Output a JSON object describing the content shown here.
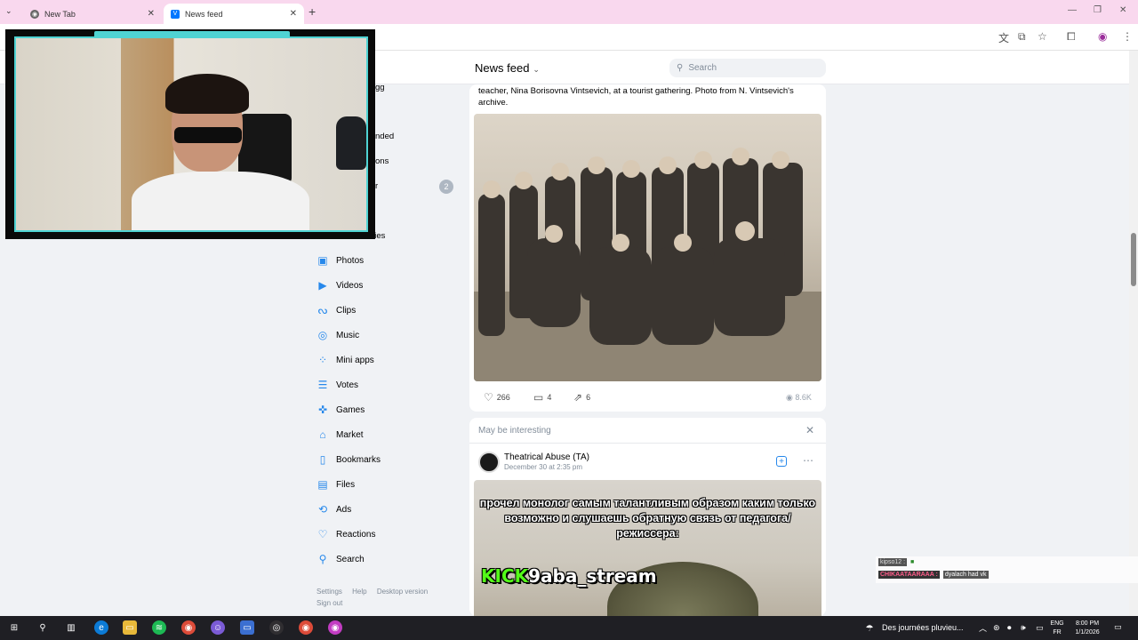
{
  "browser": {
    "tabs": [
      {
        "title": "New Tab",
        "active": false
      },
      {
        "title": "News feed",
        "active": true
      }
    ]
  },
  "header": {
    "title": "News feed",
    "search_placeholder": "Search"
  },
  "sidebar": {
    "partial_items": [
      "gg",
      "nded",
      "ons",
      "r",
      "Communities"
    ],
    "badge": "2",
    "items": [
      {
        "label": "Photos",
        "icon": "photo-icon"
      },
      {
        "label": "Videos",
        "icon": "video-icon"
      },
      {
        "label": "Clips",
        "icon": "clips-icon"
      },
      {
        "label": "Music",
        "icon": "music-icon"
      },
      {
        "label": "Mini apps",
        "icon": "mini-apps-icon"
      },
      {
        "label": "Votes",
        "icon": "votes-icon"
      },
      {
        "label": "Games",
        "icon": "games-icon"
      },
      {
        "label": "Market",
        "icon": "market-icon"
      },
      {
        "label": "Bookmarks",
        "icon": "bookmark-icon"
      },
      {
        "label": "Files",
        "icon": "file-icon"
      },
      {
        "label": "Ads",
        "icon": "ads-icon"
      },
      {
        "label": "Reactions",
        "icon": "heart-icon"
      },
      {
        "label": "Search",
        "icon": "search-icon"
      }
    ],
    "footer": {
      "settings": "Settings",
      "help": "Help",
      "desktop": "Desktop version",
      "signout": "Sign out"
    }
  },
  "post": {
    "text": "teacher, Nina Borisovna Vintsevich, at a tourist gathering. Photo from N. Vintsevich's archive.",
    "likes": "266",
    "comments": "4",
    "shares": "6",
    "views": "8.6K"
  },
  "recommendation": {
    "heading": "May be interesting",
    "author": "Theatrical Abuse (TA)",
    "date": "December 30 at 2:35 pm",
    "meme_text": "прочел монолог самым талантливым образом каким только возможно и слушаешь обратную связь от педагога/режиссера:"
  },
  "overlay": {
    "kick_brand": "KICK",
    "kick_channel": "9aba_stream",
    "chat": [
      {
        "user": "kipso12 :",
        "message": "",
        "user_color": "#dddddd"
      },
      {
        "user": "CHIKAATAARAAA :",
        "message": "dyalach had vk",
        "user_color": "#ff5c8a"
      }
    ]
  },
  "taskbar": {
    "weather": "Des journées pluvieu...",
    "lang_top": "ENG",
    "lang_bottom": "FR",
    "time": "8:00 PM",
    "date": "1/1/2026"
  }
}
